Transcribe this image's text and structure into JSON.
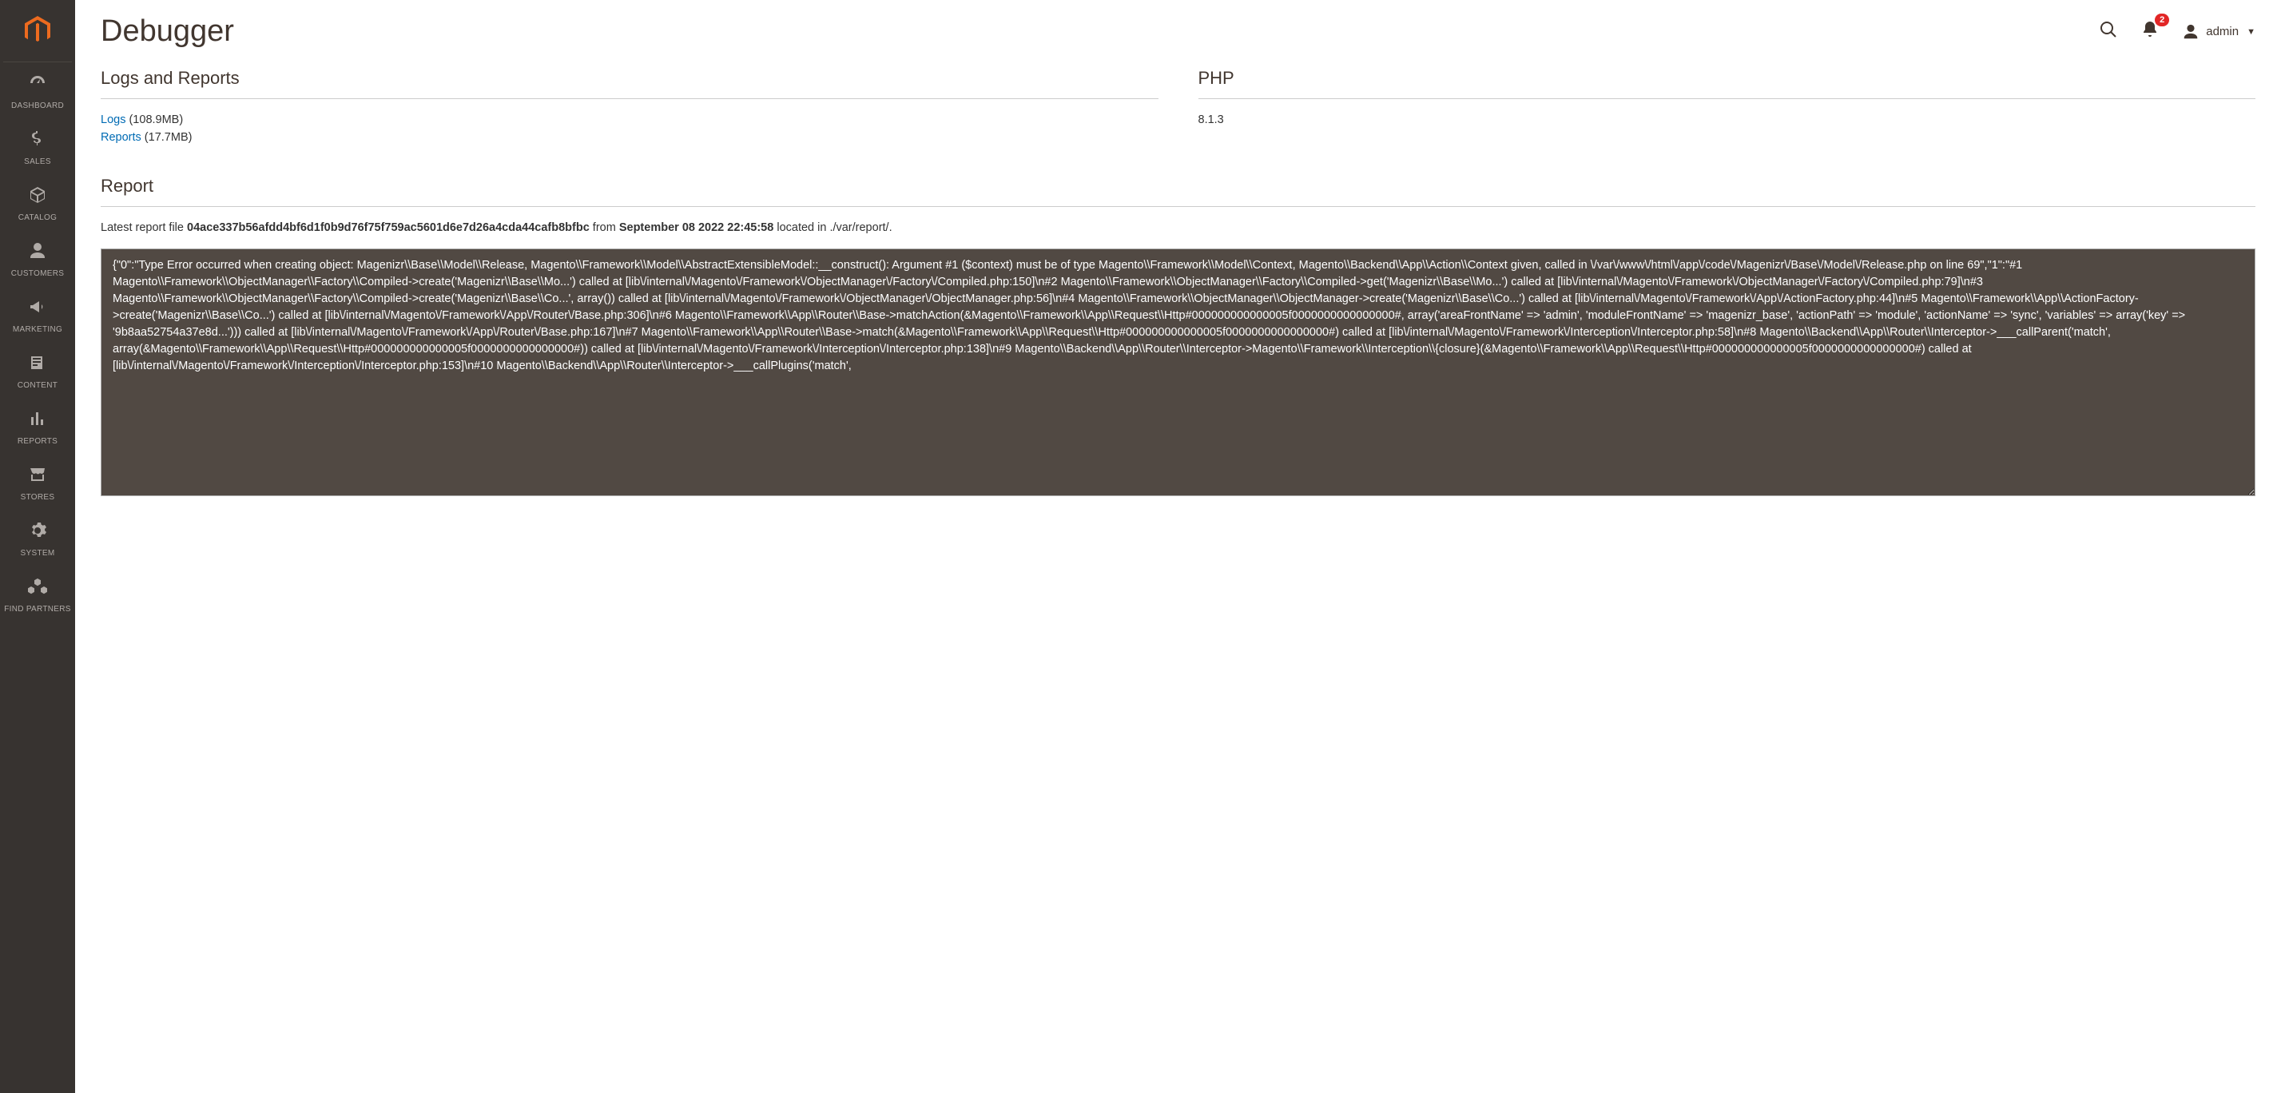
{
  "sidebar": {
    "items": [
      {
        "label": "DASHBOARD",
        "icon": "dashboard"
      },
      {
        "label": "SALES",
        "icon": "dollar"
      },
      {
        "label": "CATALOG",
        "icon": "box"
      },
      {
        "label": "CUSTOMERS",
        "icon": "person"
      },
      {
        "label": "MARKETING",
        "icon": "bullhorn"
      },
      {
        "label": "CONTENT",
        "icon": "newspaper"
      },
      {
        "label": "REPORTS",
        "icon": "chart"
      },
      {
        "label": "STORES",
        "icon": "store"
      },
      {
        "label": "SYSTEM",
        "icon": "gear"
      },
      {
        "label": "FIND PARTNERS",
        "icon": "cubes"
      }
    ]
  },
  "header": {
    "title": "Debugger",
    "notification_count": "2",
    "username": "admin"
  },
  "logs_section": {
    "title": "Logs and Reports",
    "logs_label": "Logs",
    "logs_size": " (108.9MB)",
    "reports_label": "Reports",
    "reports_size": " (17.7MB)"
  },
  "php_section": {
    "title": "PHP",
    "version": "8.1.3"
  },
  "report_section": {
    "title": "Report",
    "prefix": "Latest report file ",
    "filename": "04ace337b56afdd4bf6d1f0b9d76f75f759ac5601d6e7d26a4cda44cafb8bfbc",
    "from_text": " from ",
    "timestamp": "September 08 2022 22:45:58",
    "suffix": " located in ./var/report/.",
    "content": "{\"0\":\"Type Error occurred when creating object: Magenizr\\\\Base\\\\Model\\\\Release, Magento\\\\Framework\\\\Model\\\\AbstractExtensibleModel::__construct(): Argument #1 ($context) must be of type Magento\\\\Framework\\\\Model\\\\Context, Magento\\\\Backend\\\\App\\\\Action\\\\Context given, called in \\/var\\/www\\/html\\/app\\/code\\/Magenizr\\/Base\\/Model\\/Release.php on line 69\",\"1\":\"#1 Magento\\\\Framework\\\\ObjectManager\\\\Factory\\\\Compiled->create('Magenizr\\\\Base\\\\Mo...') called at [lib\\/internal\\/Magento\\/Framework\\/ObjectManager\\/Factory\\/Compiled.php:150]\\n#2 Magento\\\\Framework\\\\ObjectManager\\\\Factory\\\\Compiled->get('Magenizr\\\\Base\\\\Mo...') called at [lib\\/internal\\/Magento\\/Framework\\/ObjectManager\\/Factory\\/Compiled.php:79]\\n#3 Magento\\\\Framework\\\\ObjectManager\\\\Factory\\\\Compiled->create('Magenizr\\\\Base\\\\Co...', array()) called at [lib\\/internal\\/Magento\\/Framework\\/ObjectManager\\/ObjectManager.php:56]\\n#4 Magento\\\\Framework\\\\ObjectManager\\\\ObjectManager->create('Magenizr\\\\Base\\\\Co...') called at [lib\\/internal\\/Magento\\/Framework\\/App\\/ActionFactory.php:44]\\n#5 Magento\\\\Framework\\\\App\\\\ActionFactory->create('Magenizr\\\\Base\\\\Co...') called at [lib\\/internal\\/Magento\\/Framework\\/App\\/Router\\/Base.php:306]\\n#6 Magento\\\\Framework\\\\App\\\\Router\\\\Base->matchAction(&Magento\\\\Framework\\\\App\\\\Request\\\\Http#000000000000005f0000000000000000#, array('areaFrontName' => 'admin', 'moduleFrontName' => 'magenizr_base', 'actionPath' => 'module', 'actionName' => 'sync', 'variables' => array('key' => '9b8aa52754a37e8d...'))) called at [lib\\/internal\\/Magento\\/Framework\\/App\\/Router\\/Base.php:167]\\n#7 Magento\\\\Framework\\\\App\\\\Router\\\\Base->match(&Magento\\\\Framework\\\\App\\\\Request\\\\Http#000000000000005f0000000000000000#) called at [lib\\/internal\\/Magento\\/Framework\\/Interception\\/Interceptor.php:58]\\n#8 Magento\\\\Backend\\\\App\\\\Router\\\\Interceptor->___callParent('match', array(&Magento\\\\Framework\\\\App\\\\Request\\\\Http#000000000000005f0000000000000000#)) called at [lib\\/internal\\/Magento\\/Framework\\/Interception\\/Interceptor.php:138]\\n#9 Magento\\\\Backend\\\\App\\\\Router\\\\Interceptor->Magento\\\\Framework\\\\Interception\\\\{closure}(&Magento\\\\Framework\\\\App\\\\Request\\\\Http#000000000000005f0000000000000000#) called at [lib\\/internal\\/Magento\\/Framework\\/Interception\\/Interceptor.php:153]\\n#10 Magento\\\\Backend\\\\App\\\\Router\\\\Interceptor->___callPlugins('match',"
  }
}
